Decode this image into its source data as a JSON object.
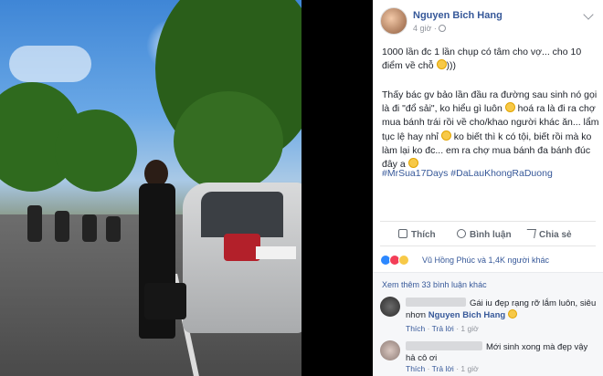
{
  "post": {
    "author": "Nguyen Bich Hang",
    "time": "4 giờ ·",
    "line1": "1000 lần đc 1 lần chụp có tâm cho       vợ... cho 10 điểm về chỗ",
    "line1_tail": ")))",
    "body_a": "Thấy bác gv bảo lần đầu ra đường sau sinh nó gọi là đi \"đổ sải\", ko hiểu gì luôn",
    "body_b": "hoá ra là đi ra chợ mua bánh trái rồi về cho/khao người khác ăn... lẩm tục lệ hay nhỉ",
    "body_c": "ko biết thì k có tội, biết rồi mà ko làm lại ko đc... em ra chợ mua bánh đa bánh đúc đây a",
    "hashtags": "#MrSua17Days #DaLauKhongRaDuong"
  },
  "actions": {
    "like": "Thích",
    "comment": "Bình luận",
    "share": "Chia sẻ"
  },
  "reactions": {
    "summary": "Vũ Hồng Phúc và 1,4K người khác"
  },
  "comments": {
    "more": "Xem thêm 33 bình luận khác",
    "c1_text_a": "Gái iu đẹp rạng rỡ lắm luôn, siêu nhơn",
    "c1_mention": "Nguyen Bich Hang",
    "c1_like": "Thích",
    "c1_reply": "Trả lời",
    "c1_time": "· 1 giờ",
    "c2_text_a": "Mới sinh xong mà đẹp vậy",
    "c2_text_b": "hả cô ơi",
    "c2_like": "Thích",
    "c2_reply": "Trả lời",
    "c2_time": "· 1 giờ"
  },
  "colors": {
    "link": "#365899",
    "like_react": "#2d88ff",
    "love_react": "#f33e58",
    "haha_react": "#f7c948"
  }
}
